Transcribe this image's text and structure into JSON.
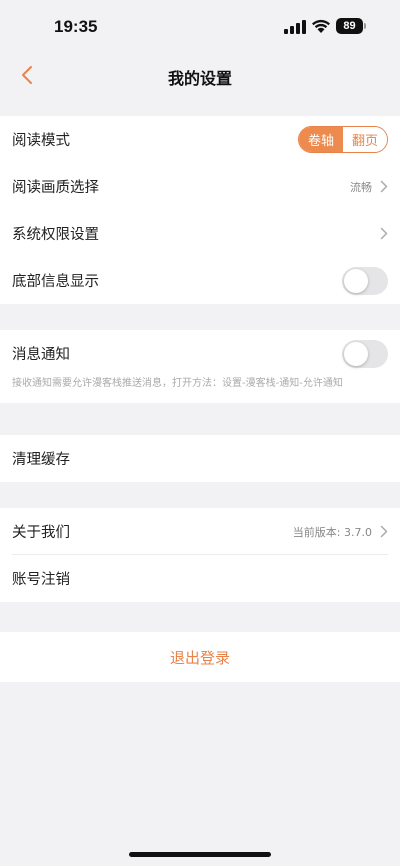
{
  "status_bar": {
    "time": "19:35",
    "battery": "89"
  },
  "nav": {
    "title": "我的设置"
  },
  "settings": {
    "reading_mode": {
      "label": "阅读模式",
      "options": [
        "卷轴",
        "翻页"
      ],
      "selected": "卷轴"
    },
    "image_quality": {
      "label": "阅读画质选择",
      "value": "流畅"
    },
    "permissions": {
      "label": "系统权限设置"
    },
    "bottom_info": {
      "label": "底部信息显示",
      "enabled": false
    },
    "notifications": {
      "label": "消息通知",
      "enabled": false,
      "hint": "接收通知需要允许漫客栈推送消息，打开方法：设置-漫客栈-通知-允许通知"
    },
    "clear_cache": {
      "label": "清理缓存"
    },
    "about": {
      "label": "关于我们",
      "value": "当前版本: 3.7.0"
    },
    "delete_account": {
      "label": "账号注销"
    }
  },
  "logout": {
    "label": "退出登录"
  },
  "colors": {
    "accent": "#ed8a4e",
    "background": "#f2f2f4"
  }
}
